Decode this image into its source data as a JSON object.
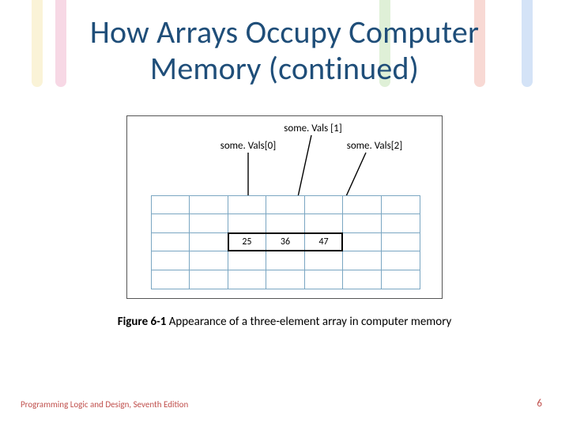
{
  "title": "How Arrays Occupy Computer Memory (continued)",
  "labels": {
    "top": "some. Vals [1]",
    "left": "some. Vals[0]",
    "right": "some. Vals[2]"
  },
  "array_values": [
    "25",
    "36",
    "47"
  ],
  "caption": {
    "fig_label": "Figure 6-1",
    "text": " Appearance of a three-element array in computer memory"
  },
  "footer": {
    "left": "Programming Logic and Design, Seventh Edition",
    "right": "6"
  },
  "chart_data": {
    "type": "table",
    "title": "Appearance of a three-element array in computer memory",
    "grid": {
      "rows": 5,
      "cols": 7
    },
    "array_row_index": 2,
    "array_col_start": 2,
    "series": [
      {
        "name": "some.Vals[0]",
        "values": [
          25
        ]
      },
      {
        "name": "some.Vals[1]",
        "values": [
          36
        ]
      },
      {
        "name": "some.Vals[2]",
        "values": [
          47
        ]
      }
    ]
  }
}
